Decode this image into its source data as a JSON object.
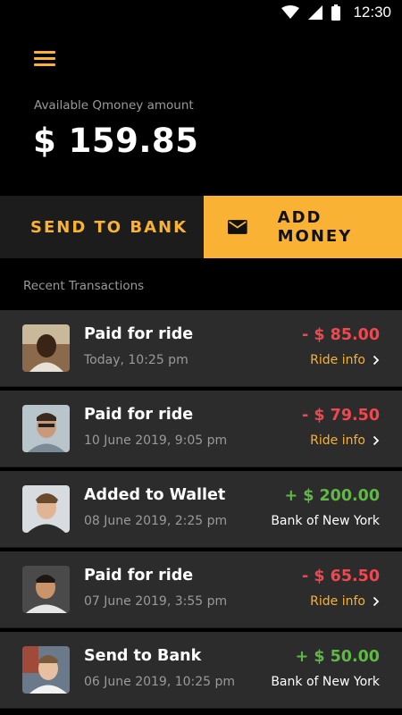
{
  "status_bar": {
    "time": "12:30",
    "icons": [
      "wifi-icon",
      "signal-icon",
      "battery-icon"
    ]
  },
  "header": {
    "menu_icon": "hamburger-menu-icon",
    "balance_label": "Available Qmoney amount",
    "balance_value": "$ 159.85"
  },
  "actions": {
    "send_to_bank": "SEND TO BANK",
    "add_money": "ADD MONEY",
    "add_money_icon": "envelope-icon"
  },
  "transactions_section": {
    "title": "Recent Transactions",
    "items": [
      {
        "title": "Paid for ride",
        "date": "Today, 10:25 pm",
        "amount": "- $ 85.00",
        "type": "debit",
        "sub": "Ride info"
      },
      {
        "title": "Paid for ride",
        "date": "10 June 2019, 9:05 pm",
        "amount": "- $ 79.50",
        "type": "debit",
        "sub": "Ride info"
      },
      {
        "title": "Added to Wallet",
        "date": "08 June 2019, 2:25 pm",
        "amount": "+ $ 200.00",
        "type": "credit",
        "sub": "Bank of New York"
      },
      {
        "title": "Paid for ride",
        "date": "07 June 2019, 3:55 pm",
        "amount": "- $ 65.50",
        "type": "debit",
        "sub": "Ride info"
      },
      {
        "title": "Send to Bank",
        "date": "06 June 2019, 10:25 pm",
        "amount": "+ $ 50.00",
        "type": "credit",
        "sub": "Bank of New York"
      }
    ]
  },
  "colors": {
    "accent": "#f9b233",
    "debit": "#f0484e",
    "credit": "#5fb944",
    "card_bg": "#2c2c2c",
    "background": "#000000"
  }
}
